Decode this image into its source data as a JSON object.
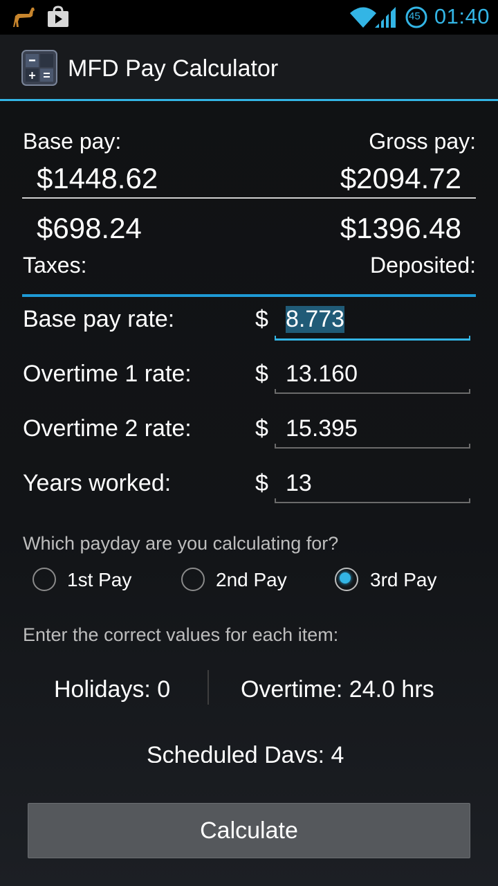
{
  "status_bar": {
    "time": "01:40",
    "notification_icons": [
      "llama-icon",
      "play-store-icon"
    ],
    "system_icons": [
      "wifi-icon",
      "signal-icon",
      "battery-icon"
    ],
    "battery_level": "45"
  },
  "app": {
    "title": "MFD Pay Calculator",
    "icon": "calculator-icon"
  },
  "summary": {
    "base_pay_label": "Base pay:",
    "base_pay_value": "$1448.62",
    "gross_pay_label": "Gross pay:",
    "gross_pay_value": "$2094.72",
    "taxes_value": "$698.24",
    "taxes_label": "Taxes:",
    "deposited_value": "$1396.48",
    "deposited_label": "Deposited:"
  },
  "form": {
    "rows": [
      {
        "label": "Base pay rate:",
        "currency": "$",
        "value": "8.773"
      },
      {
        "label": "Overtime 1 rate:",
        "currency": "$",
        "value": "13.160"
      },
      {
        "label": "Overtime 2 rate:",
        "currency": "$",
        "value": "15.395"
      },
      {
        "label": "Years worked:",
        "currency": "$",
        "value": "13"
      }
    ],
    "payday_question": "Which payday are you calculating for?",
    "payday_options": [
      {
        "label": "1st Pay",
        "checked": false
      },
      {
        "label": "2nd Pay",
        "checked": false
      },
      {
        "label": "3rd Pay",
        "checked": true
      }
    ],
    "instructions": "Enter the correct values for each item:",
    "holidays": "Holidays: 0",
    "overtime": "Overtime: 24.0 hrs",
    "scheduled_days": "Scheduled Days: 4"
  },
  "calculate_label": "Calculate",
  "colors": {
    "accent": "#33b5e5",
    "background": "#111214",
    "button": "#55585c"
  }
}
